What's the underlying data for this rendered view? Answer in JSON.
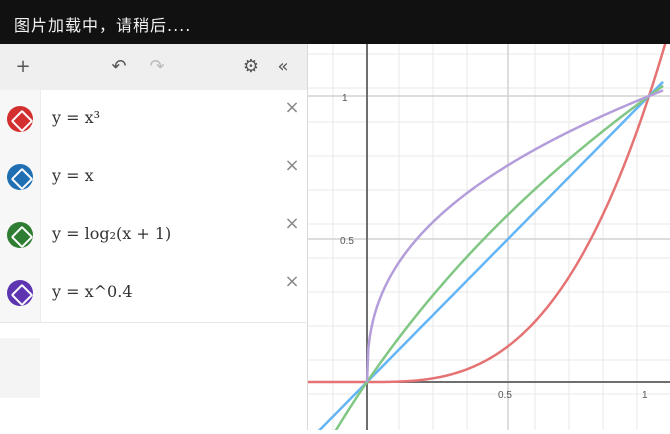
{
  "top_bar": {
    "message": "图片加载中，请稍后...."
  },
  "toolbar": {
    "add_icon": "+",
    "undo_icon": "↶",
    "redo_icon": "↷",
    "settings_icon": "⚙",
    "collapse_icon": "«"
  },
  "expressions": [
    {
      "text": "y = x³",
      "color": "#d32f2f"
    },
    {
      "text": "y = x",
      "color": "#1f6fb2"
    },
    {
      "text": "y = log₂(x + 1)",
      "color": "#2e7d32"
    },
    {
      "text": "y = x^0.4",
      "color": "#5e35b1"
    }
  ],
  "graph": {
    "ticks": {
      "y_half": "0.5",
      "y_one": "1",
      "x_half": "0.5",
      "x_one": "1"
    }
  },
  "colors": {
    "cube": "#e57373",
    "identity": "#64b5f6",
    "log": "#81c784",
    "pow04": "#b39ddb"
  }
}
